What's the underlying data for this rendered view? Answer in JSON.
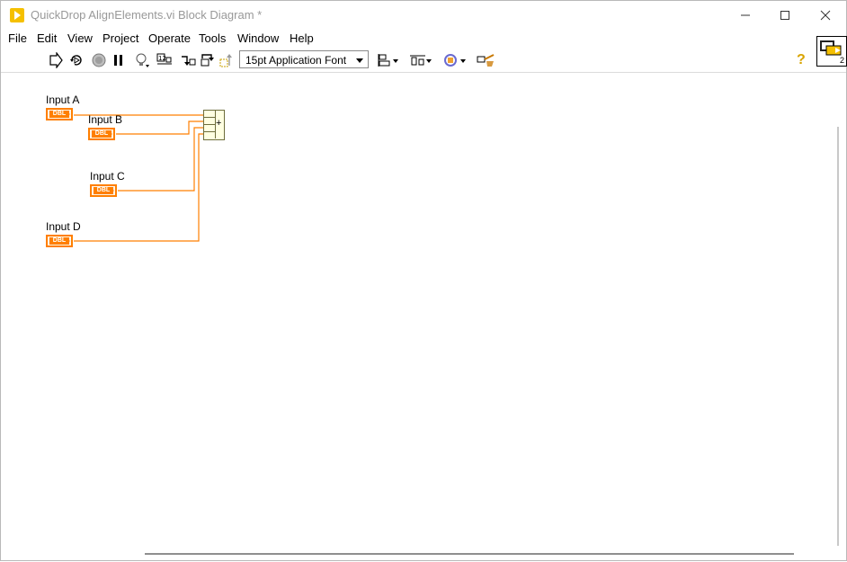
{
  "window": {
    "title": "QuickDrop AlignElements.vi Block Diagram *",
    "controls": [
      "minimize",
      "maximize",
      "close"
    ]
  },
  "menu": {
    "items": [
      "File",
      "Edit",
      "View",
      "Project",
      "Operate",
      "Tools",
      "Window",
      "Help"
    ]
  },
  "toolbar": {
    "font_select": "15pt Application Font",
    "icons": [
      "run-arrow-icon",
      "run-continuously-icon",
      "abort-icon",
      "pause-icon",
      "highlight-execution-icon",
      "retain-wire-values-icon",
      "step-into-icon",
      "step-over-icon",
      "step-out-icon",
      "align-objects-icon",
      "distribute-objects-icon",
      "reorder-icon",
      "clean-up-diagram-icon",
      "help-icon"
    ],
    "connector_pane_number": "2"
  },
  "diagram": {
    "terminals": [
      {
        "label": "Input A",
        "type": "DBL"
      },
      {
        "label": "Input B",
        "type": "DBL"
      },
      {
        "label": "Input C",
        "type": "DBL"
      },
      {
        "label": "Input D",
        "type": "DBL"
      }
    ],
    "compound_operation": "+",
    "wire_color": "#ff7f00"
  }
}
